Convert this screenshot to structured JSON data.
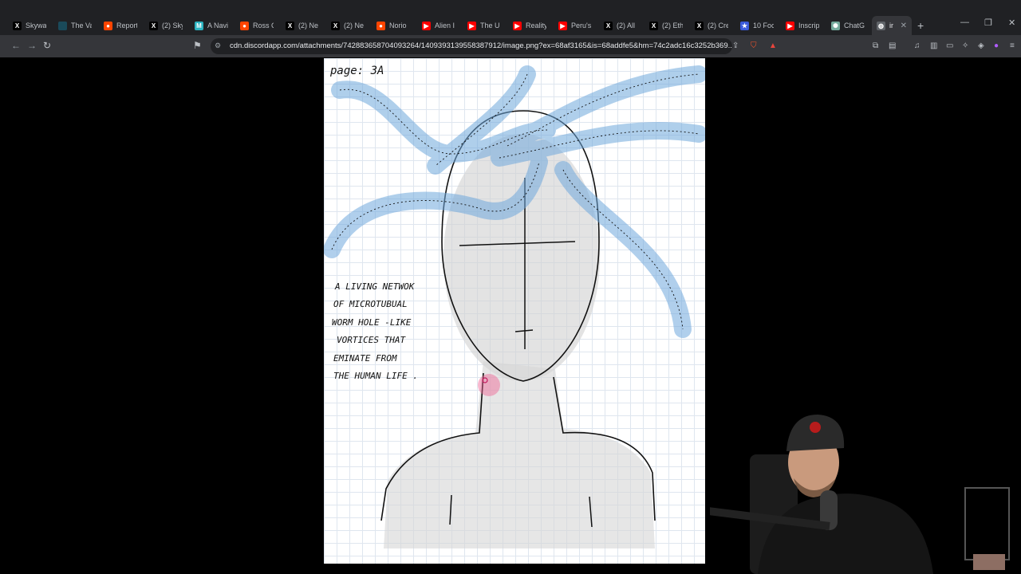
{
  "browser": {
    "tabs": [
      {
        "label": "Skywa",
        "icon": "x-logo-icon",
        "color": "#000000",
        "glyph": "X"
      },
      {
        "label": "The Va",
        "icon": "site-icon",
        "color": "#1a4a5a",
        "glyph": ""
      },
      {
        "label": "Report",
        "icon": "reddit-icon",
        "color": "#ff4500",
        "glyph": "●"
      },
      {
        "label": "(2) Sky",
        "icon": "x-logo-icon",
        "color": "#000000",
        "glyph": "X"
      },
      {
        "label": "A Navi",
        "icon": "site-icon",
        "color": "#2bb3c0",
        "glyph": "M"
      },
      {
        "label": "Ross C",
        "icon": "reddit-icon",
        "color": "#ff4500",
        "glyph": "●"
      },
      {
        "label": "(2) Ne",
        "icon": "x-logo-icon",
        "color": "#000000",
        "glyph": "X"
      },
      {
        "label": "(2) Ne",
        "icon": "x-logo-icon",
        "color": "#000000",
        "glyph": "X"
      },
      {
        "label": "Norio",
        "icon": "reddit-icon",
        "color": "#ff4500",
        "glyph": "●"
      },
      {
        "label": "Alien I",
        "icon": "youtube-icon",
        "color": "#ff0000",
        "glyph": "▶"
      },
      {
        "label": "The U",
        "icon": "youtube-icon",
        "color": "#ff0000",
        "glyph": "▶"
      },
      {
        "label": "Reality",
        "icon": "youtube-icon",
        "color": "#ff0000",
        "glyph": "▶"
      },
      {
        "label": "Peru's",
        "icon": "youtube-icon",
        "color": "#ff0000",
        "glyph": "▶"
      },
      {
        "label": "(2) All",
        "icon": "x-logo-icon",
        "color": "#000000",
        "glyph": "X"
      },
      {
        "label": "(2) Eth",
        "icon": "x-logo-icon",
        "color": "#000000",
        "glyph": "X"
      },
      {
        "label": "(2) Cre",
        "icon": "x-logo-icon",
        "color": "#000000",
        "glyph": "X"
      },
      {
        "label": "10 Foc",
        "icon": "star-icon",
        "color": "#3b5bdb",
        "glyph": "★"
      },
      {
        "label": "Inscrip",
        "icon": "youtube-icon",
        "color": "#ff0000",
        "glyph": "▶"
      },
      {
        "label": "ChatG",
        "icon": "chatgpt-icon",
        "color": "#74aa9c",
        "glyph": "✺"
      },
      {
        "label": "im",
        "icon": "globe-icon",
        "color": "#5f6368",
        "glyph": "◍",
        "active": true
      }
    ],
    "new_tab_glyph": "+",
    "window": {
      "minimize": "—",
      "restore": "❐",
      "close": "✕"
    },
    "url": "cdn.discordapp.com/attachments/742883658704093264/1409393139558387912/image.png?ex=68af3165&is=68addfe5&hm=74c2adc16c3252b369...",
    "accent": "#8ab4f8"
  },
  "sketch": {
    "page_label": "page: 3A",
    "note_lines": [
      "A LIVING NETWOK",
      "OF MICROTUBUAL",
      "WORM HOLE -LIKE",
      "VORTICES THAT",
      "EMINATE FROM",
      "THE HUMAN LIFE ."
    ],
    "colors": {
      "ink": "#111111",
      "vortex": "#6fa8dc",
      "shade": "#c9c9c9",
      "cursor": "#f06292"
    }
  }
}
